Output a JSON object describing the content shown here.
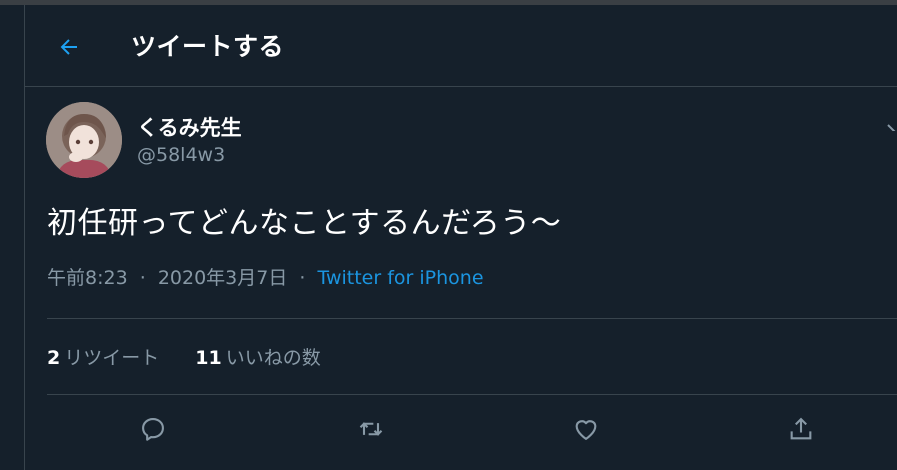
{
  "header": {
    "title": "ツイートする"
  },
  "tweet": {
    "display_name": "くるみ先生",
    "handle": "@58l4w3",
    "text": "初任研ってどんなことするんだろう～",
    "time": "午前8:23",
    "date": "2020年3月7日",
    "separator": "·",
    "source": "Twitter for iPhone"
  },
  "stats": {
    "retweets_count": "2",
    "retweets_label": "リツイート",
    "likes_count": "11",
    "likes_label": "いいねの数"
  },
  "colors": {
    "background": "#15202b",
    "border": "#38444d",
    "secondary_text": "#8899a6",
    "accent": "#1b95e0"
  },
  "icons": {
    "back": "arrow-left-icon",
    "reply": "reply-icon",
    "retweet": "retweet-icon",
    "like": "heart-icon",
    "share": "share-icon",
    "more": "chevron-down-icon"
  }
}
